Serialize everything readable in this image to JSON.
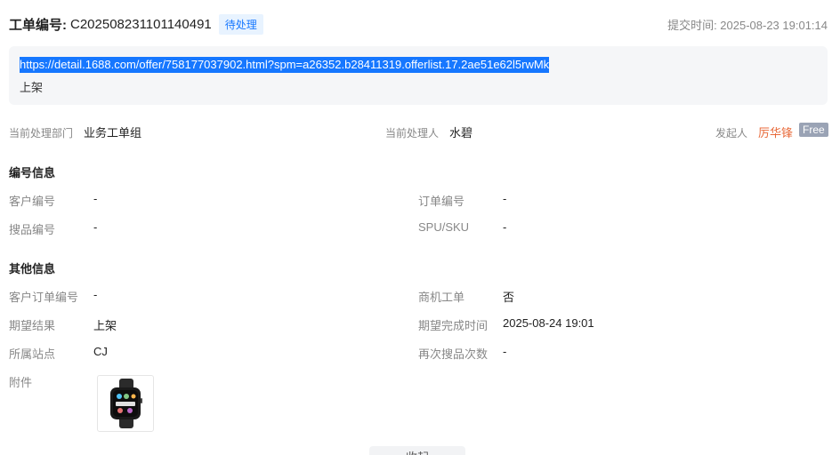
{
  "header": {
    "title_label": "工单编号:",
    "ticket_number": "C202508231101140491",
    "status": "待处理",
    "submit_time": "提交时间: 2025-08-23 19:01:14"
  },
  "url_box": {
    "url": "https://detail.1688.com/offer/758177037902.html?spm=a26352.b28411319.offerlist.17.2ae51e62l5rwMk",
    "subtext": "上架"
  },
  "handler": {
    "dept_label": "当前处理部门",
    "dept_value": "业务工单组",
    "person_label": "当前处理人",
    "person_value": "水碧",
    "initiator_label": "发起人",
    "initiator_value": "厉华锋",
    "free_tag": "Free"
  },
  "sections": {
    "numbering_title": "编号信息",
    "other_title": "其他信息"
  },
  "numbering": {
    "customer_no_label": "客户编号",
    "customer_no_value": "-",
    "order_no_label": "订单编号",
    "order_no_value": "-",
    "search_no_label": "搜品编号",
    "search_no_value": "-",
    "spu_label": "SPU/SKU",
    "spu_value": "-"
  },
  "other": {
    "cust_order_label": "客户订单编号",
    "cust_order_value": "-",
    "biz_ticket_label": "商机工单",
    "biz_ticket_value": "否",
    "expected_result_label": "期望结果",
    "expected_result_value": "上架",
    "expected_time_label": "期望完成时间",
    "expected_time_value": "2025-08-24 19:01",
    "site_label": "所属站点",
    "site_value": "CJ",
    "research_count_label": "再次搜品次数",
    "research_count_value": "-",
    "attachment_label": "附件"
  },
  "footer": {
    "collapse_label": "收起"
  },
  "colors": {
    "accent": "#1677ff",
    "initiator": "#e86a3a",
    "free_tag_bg": "#9aa3b5"
  }
}
